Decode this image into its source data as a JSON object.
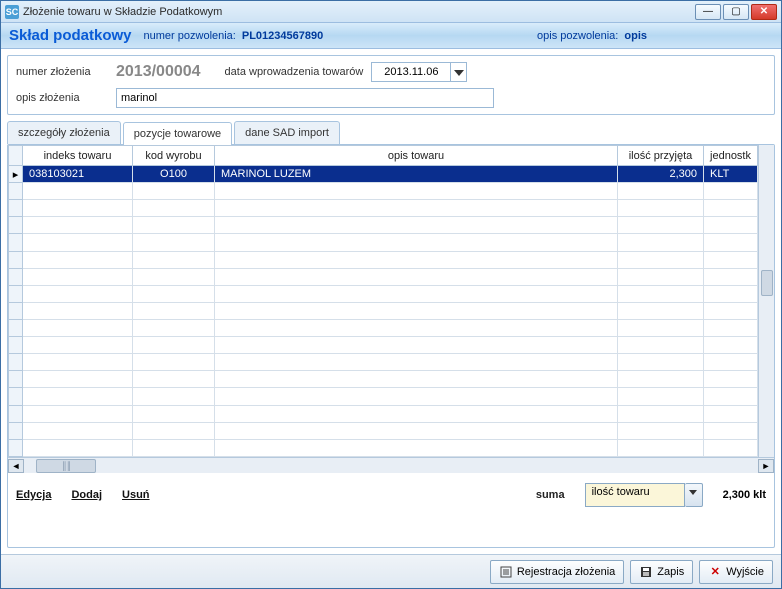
{
  "titlebar": {
    "icon_text": "SC",
    "title": "Złożenie towaru w Składzie Podatkowym"
  },
  "header": {
    "brand": "Skład podatkowy",
    "permit_label": "numer pozwolenia:",
    "permit_value": "PL01234567890",
    "desc_label": "opis pozwolenia:",
    "desc_value": "opis"
  },
  "form": {
    "submission_num_label": "numer złożenia",
    "submission_num_value": "2013/00004",
    "date_label": "data wprowadzenia towarów",
    "date_value": "2013.11.06",
    "desc_label": "opis złożenia",
    "desc_value": "marinol"
  },
  "tabs": {
    "t0": "szczegóły złożenia",
    "t1": "pozycje towarowe",
    "t2": "dane SAD import"
  },
  "grid": {
    "headers": {
      "idx": "indeks towaru",
      "kod": "kod wyrobu",
      "desc": "opis towaru",
      "qty": "ilość przyjęta",
      "unit": "jednostk"
    },
    "row0": {
      "idx": "038103021",
      "kod": "O100",
      "desc": "MARINOL LUZEM",
      "qty": "2,300",
      "unit": "KLT"
    }
  },
  "actions": {
    "edit": "Edycja",
    "add": "Dodaj",
    "del": "Usuń",
    "sum_label": "suma",
    "sum_combo": "ilość towaru",
    "sum_value": "2,300 klt"
  },
  "bottom": {
    "register": "Rejestracja złożenia",
    "save": "Zapis",
    "exit": "Wyjście"
  }
}
